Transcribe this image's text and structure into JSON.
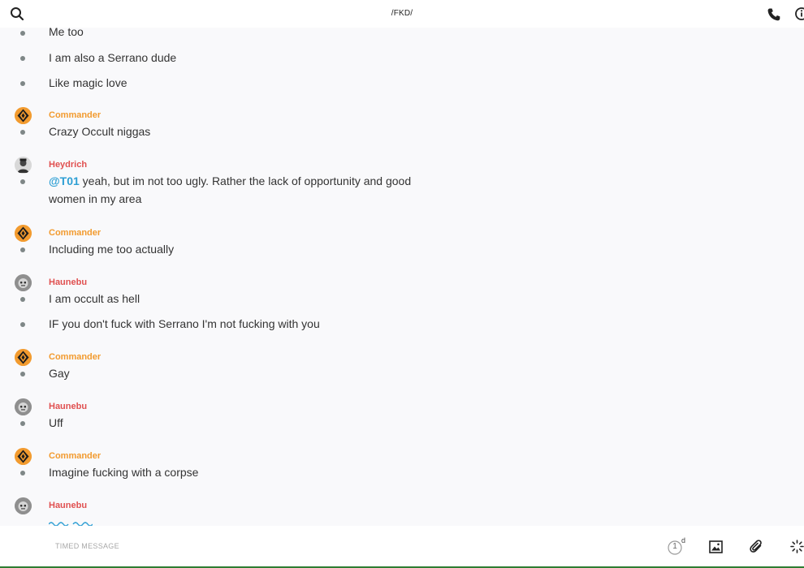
{
  "header": {
    "title": "/FKD/",
    "search_icon": "search-icon",
    "phone_icon": "phone-icon",
    "info_icon": "info-icon"
  },
  "messages": [
    {
      "text": "Me too"
    },
    {
      "text": "I am also a Serrano dude"
    },
    {
      "text": "Like magic love"
    },
    {
      "author": "Commander",
      "text": "Crazy Occult niggas"
    },
    {
      "author": "Heydrich",
      "mention": "@T01",
      "text": " yeah, but im not too ugly. Rather the lack of opportunity and good women in my area"
    },
    {
      "author": "Commander",
      "text": "Including me too actually"
    },
    {
      "author": "Haunebu",
      "text": "I am occult as hell"
    },
    {
      "text": "IF you don't fuck with Serrano I'm not fucking with you"
    },
    {
      "author": "Commander",
      "text": "Gay"
    },
    {
      "author": "Haunebu",
      "text": "Uff"
    },
    {
      "author": "Commander",
      "text": "Imagine fucking with a corpse"
    },
    {
      "author": "Haunebu",
      "text": ""
    }
  ],
  "composer": {
    "placeholder": "TIMED MESSAGE",
    "timer_value": "1",
    "timer_unit": "d"
  },
  "colors": {
    "commander": "#f29b2f",
    "haunebu": "#e05050",
    "heydrich": "#e05050",
    "mention": "#2e9fd4",
    "bullet": "#7f8787"
  }
}
